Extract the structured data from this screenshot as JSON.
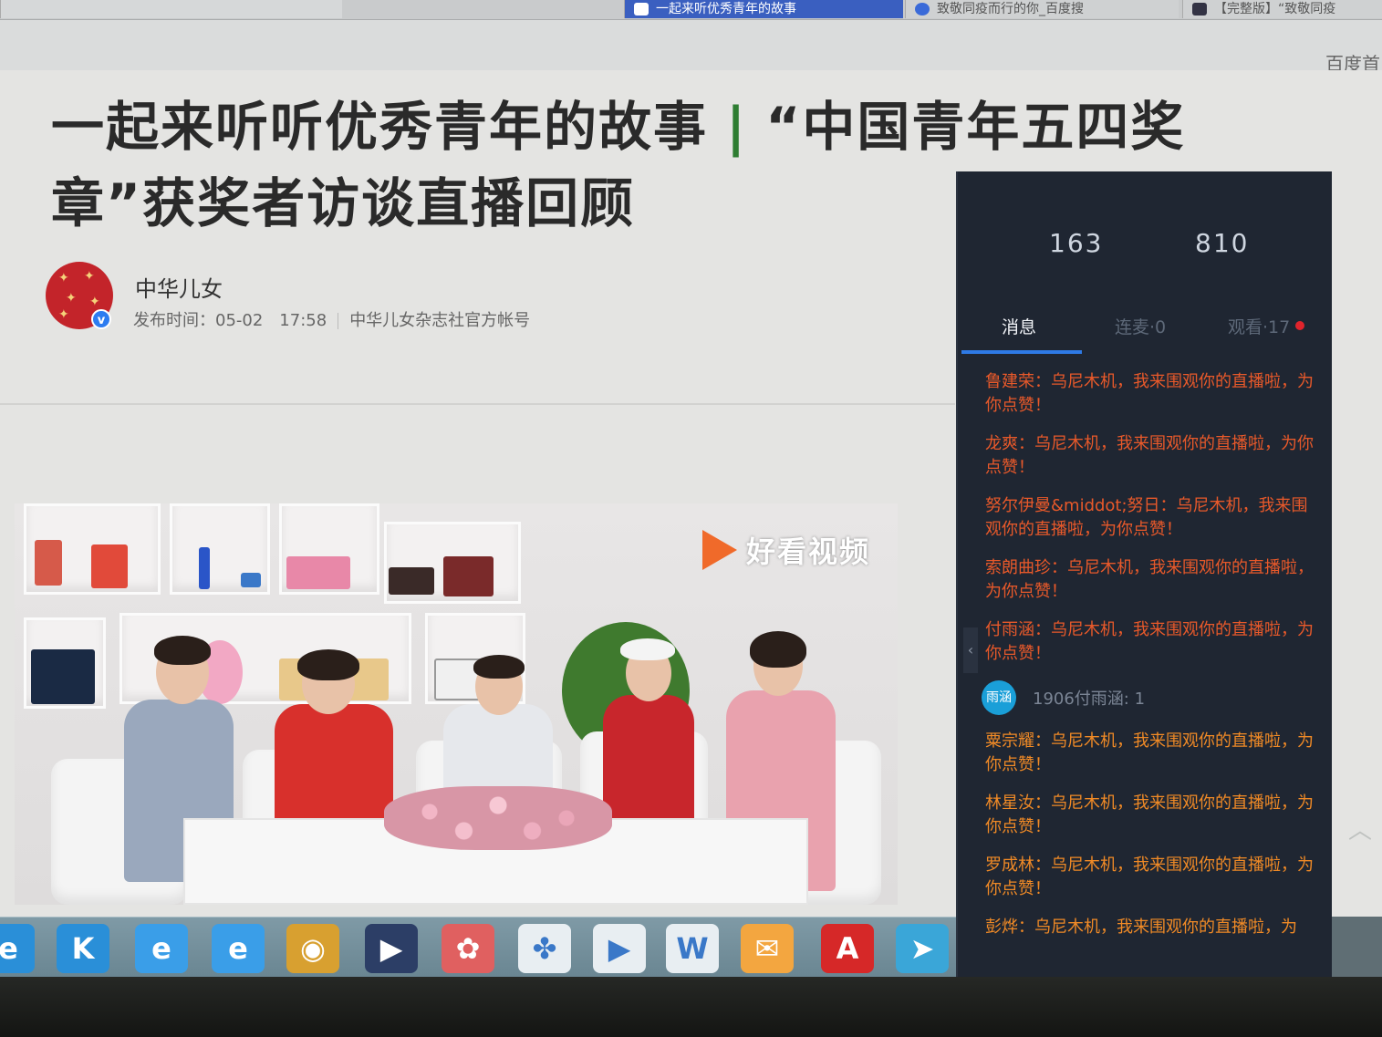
{
  "browser": {
    "tabs": [
      {
        "label": ""
      },
      {
        "label": "一起来听优秀青年的故事"
      },
      {
        "label": "致敬同疫而行的你_百度搜"
      },
      {
        "label": "【完整版】“致敬同疫"
      }
    ],
    "baidu_link": "百度首"
  },
  "article": {
    "title_part1": "一起来听听优秀青年的故事",
    "title_separator": "|",
    "title_part2": "“中国青年五四奖章”获奖者访谈直播回顾",
    "author_name": "中华儿女",
    "publish_label": "发布时间：05-02　17:58",
    "account_label": "中华儿女杂志社官方帐号",
    "verified_mark": "v"
  },
  "video": {
    "logo_text": "好看视频",
    "colors": {
      "logo": "#f06a2a"
    }
  },
  "live_panel": {
    "stats": {
      "left": "163",
      "right": "810"
    },
    "tabs": [
      {
        "label": "消息",
        "active": true
      },
      {
        "label": "连麦·0",
        "active": false
      },
      {
        "label": "观看·17",
        "active": false
      }
    ],
    "messages": [
      {
        "text": "鲁建荣：乌尼木机，我来围观你的直播啦，为你点赞！",
        "style": "red"
      },
      {
        "text": "龙爽：乌尼木机，我来围观你的直播啦，为你点赞！",
        "style": "red"
      },
      {
        "text": "努尔伊曼&middot;努日：乌尼木机，我来围观你的直播啦，为你点赞！",
        "style": "red"
      },
      {
        "text": "索朗曲珍：乌尼木机，我来围观你的直播啦，为你点赞！",
        "style": "red"
      },
      {
        "text": "付雨涵：乌尼木机，我来围观你的直播啦，为你点赞！",
        "style": "red"
      }
    ],
    "user_row": {
      "avatar_text": "雨涵",
      "text": "1906付雨涵: 1"
    },
    "messages_after": [
      {
        "text": "粟宗耀：乌尼木机，我来围观你的直播啦，为你点赞！",
        "style": "orange"
      },
      {
        "text": "林星汝：乌尼木机，我来围观你的直播啦，为你点赞！",
        "style": "orange"
      },
      {
        "text": "罗成林：乌尼木机，我来围观你的直播啦，为你点赞！",
        "style": "orange"
      },
      {
        "text": "彭烨：乌尼木机，我来围观你的直播啦，为",
        "style": "orange"
      }
    ],
    "colors": {
      "message_red": "#e8592a",
      "message_orange": "#f08a26",
      "tab_active": "#2e7ae6"
    }
  },
  "taskbar": {
    "icons": [
      {
        "name": "ie-partial-icon",
        "glyph": "e",
        "color": "#2a8fd8"
      },
      {
        "name": "kugou-icon",
        "glyph": "K",
        "color": "#2a8fd8"
      },
      {
        "name": "ie-icon",
        "glyph": "e",
        "color": "#3a9ee8"
      },
      {
        "name": "ie-icon-2",
        "glyph": "e",
        "color": "#3a9ee8"
      },
      {
        "name": "chrome-icon",
        "glyph": "◉",
        "color": "#d8a030"
      },
      {
        "name": "video-camera-icon",
        "glyph": "▶",
        "color": "#2c3e66"
      },
      {
        "name": "pinwheel-icon",
        "glyph": "✿",
        "color": "#e06060"
      },
      {
        "name": "cloud-icon",
        "glyph": "✤",
        "color": "#e8eef2"
      },
      {
        "name": "player-icon",
        "glyph": "▶",
        "color": "#e8eef2"
      },
      {
        "name": "word-icon",
        "glyph": "W",
        "color": "#e8eef2"
      },
      {
        "name": "wechat-icon",
        "glyph": "✉",
        "color": "#f3a640"
      },
      {
        "name": "pdf-icon",
        "glyph": "A",
        "color": "#d62828"
      },
      {
        "name": "send-icon",
        "glyph": "➤",
        "color": "#3aa6d8"
      }
    ]
  }
}
